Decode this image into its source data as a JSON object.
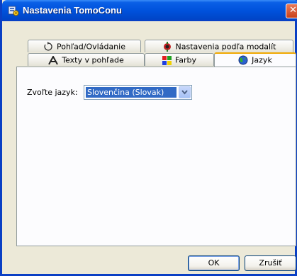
{
  "window": {
    "title": "Nastavenia TomoConu",
    "close_glyph": "✕"
  },
  "tabs": {
    "back_row": [
      {
        "label": "Pohľad/Ovládanie",
        "icon": "rotate-icon"
      },
      {
        "label": "Nastavenia podľa modalít",
        "icon": "modality-icon"
      }
    ],
    "front_row": [
      {
        "label": "Texty v pohľade",
        "icon": "text-a-icon"
      },
      {
        "label": "Farby",
        "icon": "color-squares-icon"
      },
      {
        "label": "Jazyk",
        "icon": "globe-icon",
        "active": true
      }
    ]
  },
  "language": {
    "label": "Zvoľte jazyk:",
    "selected": "Slovenčina (Slovak)"
  },
  "buttons": {
    "ok": "OK",
    "cancel": "Zrušiť"
  },
  "colors": {
    "titlebar": "#0052dc",
    "selection": "#316ac5",
    "active_tab_accent": "#f0a800"
  }
}
